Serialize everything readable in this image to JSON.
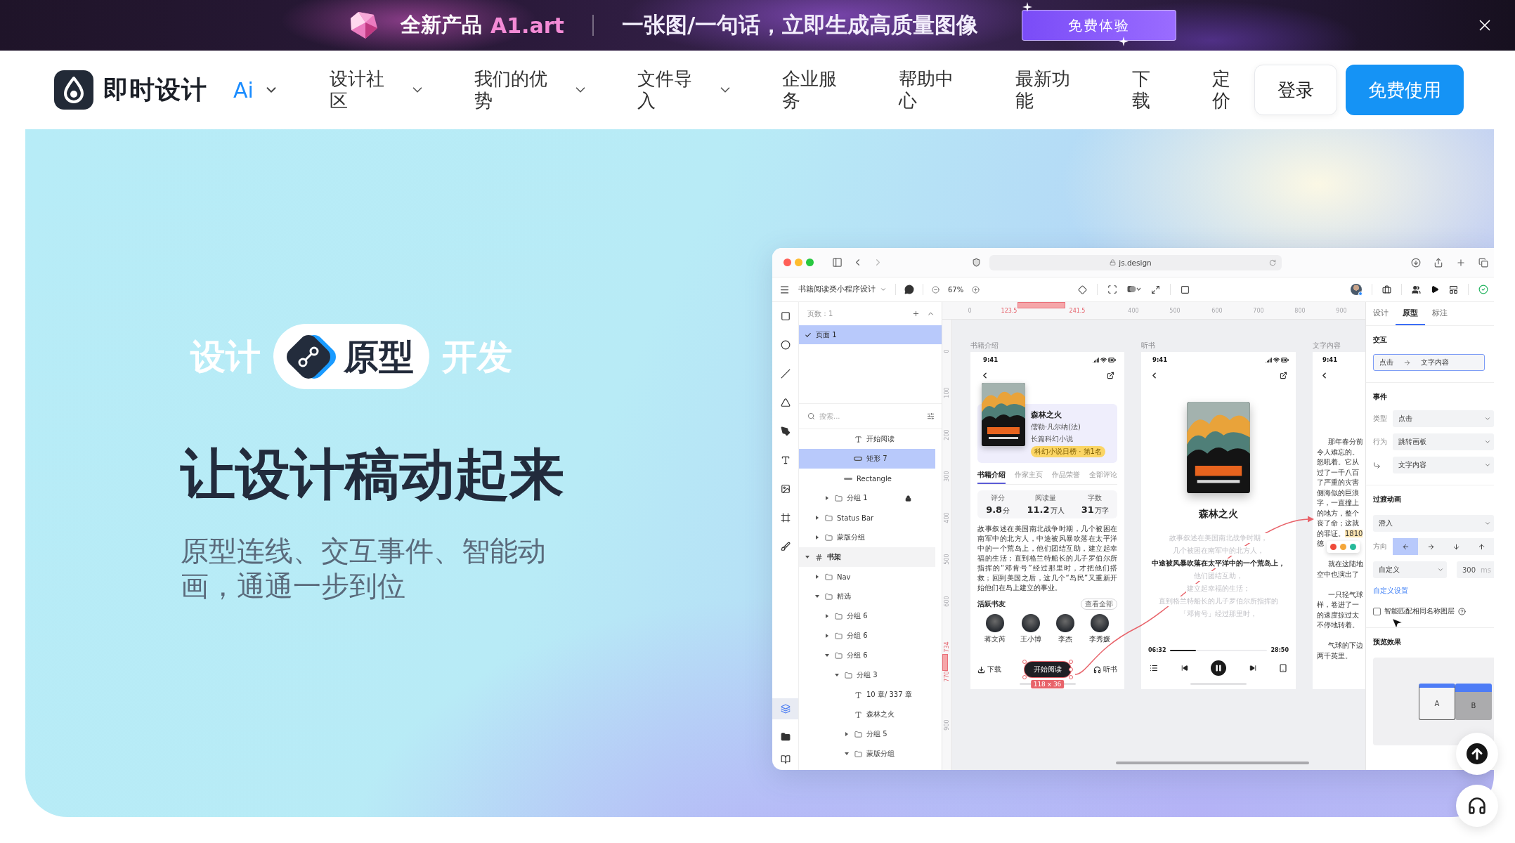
{
  "promo_banner": {
    "product_label": "全新产品",
    "product_name": "A1.art",
    "tagline": "一张图/一句话，立即生成高质量图像",
    "cta_button": "免费体验"
  },
  "navbar": {
    "brand": "即时设计",
    "ai_menu": "Ai",
    "items": [
      {
        "label": "设计社区",
        "has_menu": true
      },
      {
        "label": "我们的优势",
        "has_menu": true
      },
      {
        "label": "文件导入",
        "has_menu": true
      },
      {
        "label": "企业服务",
        "has_menu": false
      },
      {
        "label": "帮助中心",
        "has_menu": false
      },
      {
        "label": "最新功能",
        "has_menu": false
      },
      {
        "label": "下载",
        "has_menu": false
      },
      {
        "label": "定价",
        "has_menu": false
      }
    ],
    "login_button": "登录",
    "signup_button": "免费使用"
  },
  "hero": {
    "modes": [
      {
        "label": "设计",
        "selected": false
      },
      {
        "label": "原型",
        "selected": true
      },
      {
        "label": "开发",
        "selected": false
      }
    ],
    "headline": "让设计稿动起来",
    "subtitle": "原型连线、交互事件、智能动画，通通一步到位"
  },
  "app_window": {
    "browser": {
      "url": "js.design"
    },
    "toolbar": {
      "file_name": "书籍阅读类小程序设计",
      "zoom": "67%"
    },
    "layers_panel": {
      "page_count": "页数：1",
      "pages": [
        {
          "name": "页面 1",
          "selected": true
        }
      ],
      "search_placeholder": "搜索...",
      "layers": [
        {
          "children": [
            {
              "children": [
                {
                  "children": [
                    {
                      "children": [
                        {
                          "name": "开始阅读",
                          "kind": "text",
                          "selected": false,
                          "locked": false
                        },
                        {
                          "name": "矩形 7",
                          "kind": "shape",
                          "selected": true,
                          "locked": false
                        }
                      ]
                    },
                    {
                      "name": "Rectangle",
                      "kind": "line",
                      "selected": false,
                      "locked": false
                    }
                  ]
                },
                {
                  "name": "分组 1",
                  "kind": "group",
                  "expanded": false,
                  "selected": false,
                  "locked": true
                }
              ]
            },
            {
              "name": "Status Bar",
              "kind": "group",
              "expanded": false,
              "selected": false,
              "locked": false
            },
            {
              "name": "蒙版分组",
              "kind": "group",
              "expanded": false,
              "selected": false,
              "locked": false
            }
          ]
        },
        {
          "name": "书架",
          "kind": "frame",
          "expanded": true,
          "selected": false,
          "locked": false,
          "children": [
            {
              "name": "Nav",
              "kind": "group",
              "expanded": false,
              "selected": false,
              "locked": false
            },
            {
              "name": "精选",
              "kind": "group",
              "expanded": true,
              "selected": false,
              "locked": false,
              "children": [
                {
                  "name": "分组 6",
                  "kind": "group",
                  "expanded": false,
                  "selected": false,
                  "locked": false
                },
                {
                  "name": "分组 6",
                  "kind": "group",
                  "expanded": false,
                  "selected": false,
                  "locked": false
                },
                {
                  "name": "分组 6",
                  "kind": "group",
                  "expanded": true,
                  "selected": false,
                  "locked": false,
                  "children": [
                    {
                      "name": "分组 3",
                      "kind": "group",
                      "expanded": true,
                      "selected": false,
                      "locked": false,
                      "children": [
                        {
                          "name": "10 章/ 337 章",
                          "kind": "text",
                          "selected": false,
                          "locked": false
                        },
                        {
                          "name": "森林之火",
                          "kind": "text",
                          "selected": false,
                          "locked": false
                        },
                        {
                          "name": "分组 5",
                          "kind": "group",
                          "expanded": false,
                          "selected": false,
                          "locked": false
                        },
                        {
                          "name": "蒙版分组",
                          "kind": "group",
                          "expanded": true,
                          "selected": false,
                          "locked": false
                        }
                      ]
                    }
                  ]
                }
              ]
            }
          ]
        }
      ]
    },
    "canvas": {
      "ruler_top": [
        {
          "label": "0",
          "highlighted": false
        },
        {
          "label": "123.5",
          "highlighted": true
        },
        {
          "label": "241.5",
          "highlighted": true
        },
        {
          "label": "400",
          "highlighted": false
        },
        {
          "label": "500",
          "highlighted": false
        },
        {
          "label": "600",
          "highlighted": false
        },
        {
          "label": "700",
          "highlighted": false
        },
        {
          "label": "800",
          "highlighted": false
        },
        {
          "label": "900",
          "highlighted": false
        }
      ],
      "ruler_left": [
        {
          "label": "0",
          "highlighted": false
        },
        {
          "label": "100",
          "highlighted": false
        },
        {
          "label": "200",
          "highlighted": false
        },
        {
          "label": "300",
          "highlighted": false
        },
        {
          "label": "400",
          "highlighted": false
        },
        {
          "label": "500",
          "highlighted": false
        },
        {
          "label": "600",
          "highlighted": false
        },
        {
          "label": "734",
          "highlighted": true
        },
        {
          "label": "770",
          "highlighted": true
        },
        {
          "label": "900",
          "highlighted": false
        }
      ],
      "frames": [
        {
          "kind": "book_detail",
          "title": "书籍介绍",
          "status_time": "9:41",
          "book": {
            "title": "森林之火",
            "author": "儒勒·凡尔纳(法)",
            "genre": "长篇科幻小说",
            "rank_badge": "科幻小说日榜 · 第1名"
          },
          "tabs": [
            {
              "label": "书籍介绍",
              "selected": true
            },
            {
              "label": "作家主页",
              "selected": false
            },
            {
              "label": "作品荣誉",
              "selected": false
            },
            {
              "label": "全部评论",
              "selected": false
            }
          ],
          "stats": [
            {
              "label": "评分",
              "value": "9.8",
              "unit": "分"
            },
            {
              "label": "阅读量",
              "value": "11.2",
              "unit": "万人"
            },
            {
              "label": "字数",
              "value": "31",
              "unit": "万字"
            }
          ],
          "summary": "故事叙述在美国南北战争时期，几个被困在南军中的北方人，中途被风暴吹落在太平洋中的一个荒岛上，他们团结互助，建立起幸福的生活；直到格兰特船长的儿子罗伯尔所指挥的“邓肯号”经过那里时，才把他们搭救；回到美国之后，这几个“岛民”又重新开始他们在岛上建立的事业。",
          "friends_title": "活跃书友",
          "friends_more": "查看全部",
          "friends": [
            {
              "name": "蒋文芮"
            },
            {
              "name": "王小博"
            },
            {
              "name": "李杰"
            },
            {
              "name": "李秀媛"
            }
          ],
          "actions": {
            "download": "下载",
            "read": {
              "label": "开始阅读",
              "selected": true
            },
            "listen": "听书"
          },
          "selection_size": "118 x 36"
        },
        {
          "kind": "audio_player",
          "title": "听书",
          "status_time": "9:41",
          "book_title": "森林之火",
          "lyrics": [
            {
              "text": "故事叙述在美国南北战争时期，",
              "current": false
            },
            {
              "text": "几个被困在南军中的北方人，",
              "current": false
            },
            {
              "text": "中途被风暴吹落在太平洋中的一个荒岛上，",
              "current": true
            },
            {
              "text": "他们团结互助，",
              "current": false
            },
            {
              "text": "建立起幸福的生活；",
              "current": false
            },
            {
              "text": "直到格兰特船长的儿子罗伯尔所指挥的",
              "current": false
            },
            {
              "text": "「邓肯号」经过那里时，",
              "current": false
            }
          ],
          "elapsed": "06:32",
          "duration": "28:50",
          "progress": {
            "level": 0.27
          },
          "playing": true
        },
        {
          "kind": "text_reader",
          "title": "文字内容",
          "status_time": "9:41",
          "paragraphs": [
            {
              "lines": [
                {
                  "text": "那年春分前"
                },
                {
                  "text": "令人难忘的。"
                },
                {
                  "text": "怒吼着。它从"
                },
                {
                  "text": "过了一千八百"
                },
                {
                  "text": "了严重的灾害"
                },
                {
                  "text": "侧海似的巨浪"
                },
                {
                  "text": "字，一直撞上"
                },
                {
                  "text": "的地方，整个"
                },
                {
                  "text": "丧了命；这就"
                },
                {
                  "text": "的罪证。",
                  "highlight": "1810"
                },
                {
                  "text": "德"
                }
              ]
            },
            {
              "lines": [
                {
                  "text": "就在这陆地"
                },
                {
                  "text": "空中也演出了"
                }
              ]
            },
            {
              "lines": [
                {
                  "text": "一只轻气球"
                },
                {
                  "text": "样，卷进了一"
                },
                {
                  "text": "的速度掠过太"
                },
                {
                  "text": "不停地转着。"
                }
              ]
            },
            {
              "lines": [
                {
                  "text": "气球的下边"
                },
                {
                  "text": "两千英里。"
                }
              ]
            }
          ],
          "color_picker": [
            {
              "color": "#ee4b3b"
            },
            {
              "color": "#f4a63a"
            },
            {
              "color": "#26b99a"
            }
          ]
        }
      ]
    },
    "inspector": {
      "tabs": [
        {
          "label": "设计",
          "selected": false
        },
        {
          "label": "原型",
          "selected": true
        },
        {
          "label": "标注",
          "selected": false
        }
      ],
      "interaction_title": "交互",
      "interaction": {
        "trigger": "点击",
        "target": "文字内容"
      },
      "event_title": "事件",
      "event_fields": [
        {
          "kind": "labeled",
          "label": "类型",
          "value": "点击"
        },
        {
          "kind": "labeled",
          "label": "行为",
          "value": "跳转画板"
        },
        {
          "kind": "target",
          "value": "文字内容"
        }
      ],
      "transition_title": "过渡动画",
      "animation": "滑入",
      "direction_label": "方向",
      "directions": [
        {
          "kind": "left",
          "selected": true
        },
        {
          "kind": "right",
          "selected": false
        },
        {
          "kind": "down",
          "selected": false
        },
        {
          "kind": "up",
          "selected": false
        }
      ],
      "easing": "自定义",
      "duration": "300",
      "duration_unit": "ms",
      "custom_link": "自定义设置",
      "smart_match": {
        "label": "智能匹配相同名称图层",
        "checked": false
      },
      "preview_title": "预览效果",
      "preview_cards": [
        {
          "label": "A",
          "kind": "current"
        },
        {
          "label": "B",
          "kind": "next"
        }
      ]
    }
  }
}
